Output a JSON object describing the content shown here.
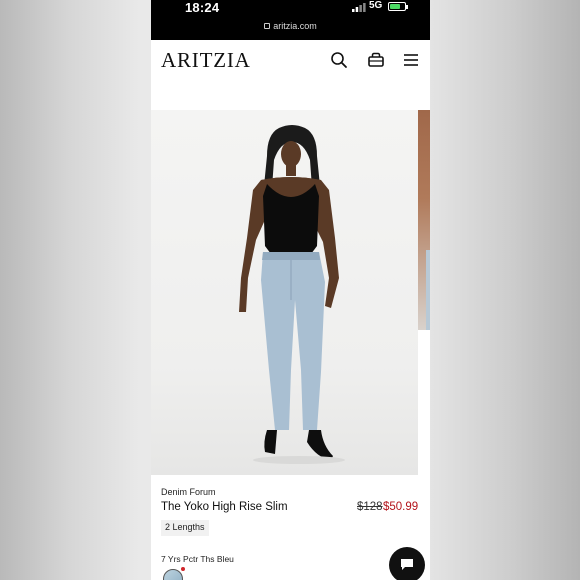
{
  "status_bar": {
    "time": "18:24",
    "network": "5G",
    "url": "aritzia.com"
  },
  "header": {
    "logo": "ARITZIA",
    "icons": [
      "search-icon",
      "bag-icon",
      "menu-icon"
    ]
  },
  "product": {
    "brand": "Denim Forum",
    "name": "The Yoko High Rise Slim",
    "price_original": "$128",
    "price_sale": "$50.99",
    "lengths_badge": "2 Lengths",
    "color_label": "7 Yrs Pctr Ths Bleu"
  },
  "colors": {
    "sale": "#b3121a",
    "battery": "#4cd964",
    "swatch": "#a8c3d3"
  }
}
